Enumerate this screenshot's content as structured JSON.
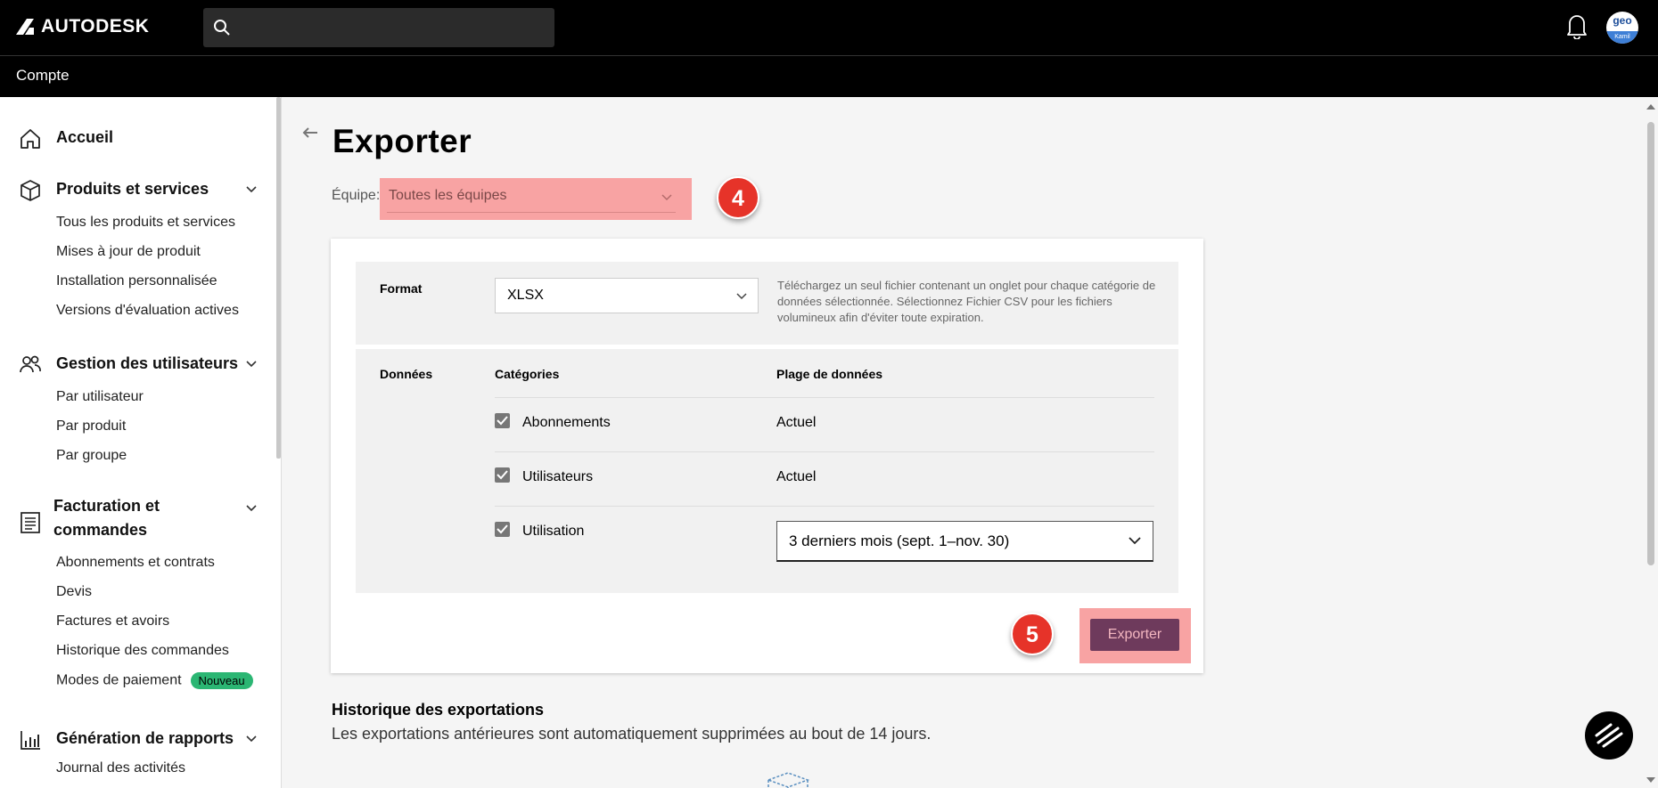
{
  "header": {
    "brand": "AUTODESK",
    "search_placeholder": "",
    "avatar_initials": "geo",
    "avatar_sub": "Kamil"
  },
  "subbar": {
    "title": "Compte"
  },
  "sidebar": {
    "home": "Accueil",
    "products": {
      "label": "Produits et services",
      "items": [
        "Tous les produits et services",
        "Mises à jour de produit",
        "Installation personnalisée",
        "Versions d'évaluation actives"
      ]
    },
    "users": {
      "label": "Gestion des utilisateurs",
      "items": [
        "Par utilisateur",
        "Par produit",
        "Par groupe"
      ]
    },
    "billing": {
      "label_line1": "Facturation et",
      "label_line2": "commandes",
      "items": [
        "Abonnements et contrats",
        "Devis",
        "Factures et avoirs",
        "Historique des commandes",
        "Modes de paiement"
      ],
      "badge": "Nouveau"
    },
    "reports": {
      "label": "Génération de rapports",
      "items": [
        "Journal des activités"
      ]
    }
  },
  "main": {
    "title": "Exporter",
    "team_label": "Équipe:",
    "team_value": "Toutes les équipes",
    "step4": "4",
    "step5": "5",
    "format_label": "Format",
    "format_value": "XLSX",
    "format_desc": "Téléchargez un seul fichier contenant un onglet pour chaque catégorie de données sélectionnée. Sélectionnez Fichier CSV pour les fichiers volumineux afin d'éviter toute expiration.",
    "data_label": "Données",
    "col_categories": "Catégories",
    "col_range": "Plage de données",
    "rows": [
      {
        "category": "Abonnements",
        "range": "Actuel",
        "checked": true
      },
      {
        "category": "Utilisateurs",
        "range": "Actuel",
        "checked": true
      },
      {
        "category": "Utilisation",
        "range": "",
        "checked": true
      }
    ],
    "usage_range": "3 derniers mois (sept. 1–nov. 30)",
    "export_button": "Exporter",
    "history_title": "Historique des exportations",
    "history_desc": "Les exportations antérieures sont automatiquement supprimées au bout de 14 jours."
  },
  "colors": {
    "highlight": "#f8a3a3",
    "step_badge": "#e63329",
    "badge_new": "#2bb673",
    "export_btn": "#6e3a5c"
  }
}
